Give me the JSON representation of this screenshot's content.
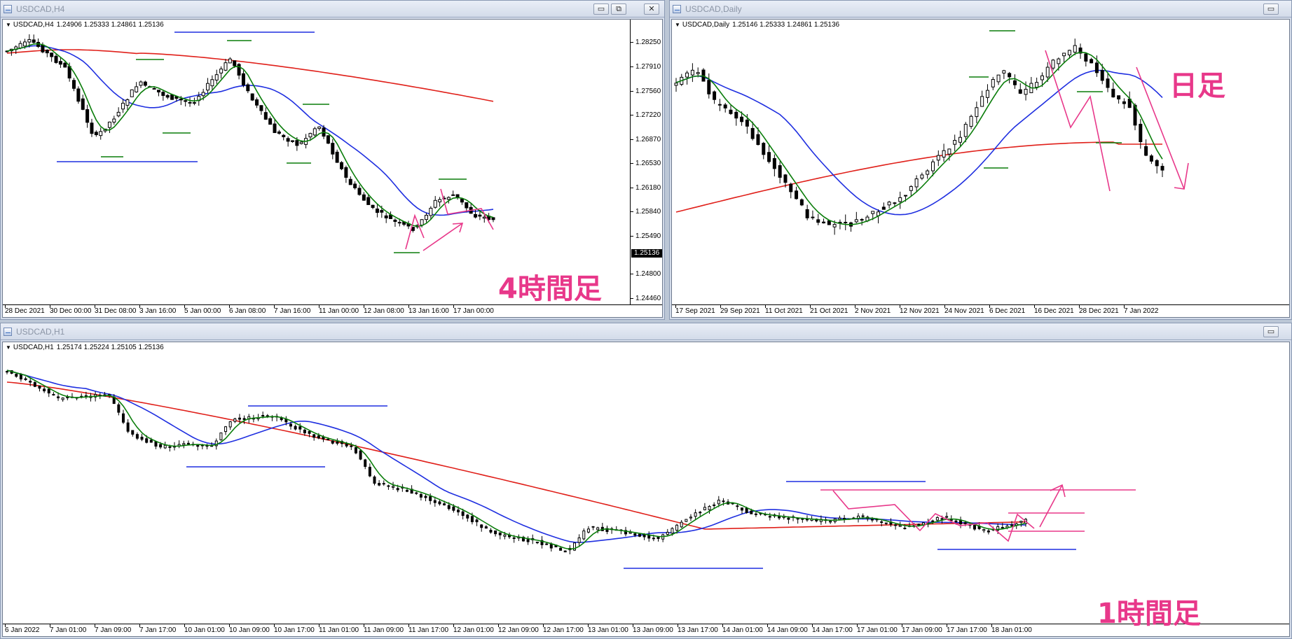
{
  "windows": {
    "h4": {
      "title": "USDCAD,H4",
      "symbol": "USDCAD,H4",
      "ohlc": "1.24906 1.25333 1.24861 1.25136",
      "y_ticks": [
        "1.28250",
        "1.27910",
        "1.27560",
        "1.27220",
        "1.26870",
        "1.26530",
        "1.26180",
        "1.25840",
        "1.25490",
        "1.25136",
        "1.24800",
        "1.24460"
      ],
      "current_price": "1.25136",
      "x_ticks": [
        "28 Dec 2021",
        "30 Dec 00:00",
        "31 Dec 08:00",
        "3 Jan 16:00",
        "5 Jan 00:00",
        "6 Jan 08:00",
        "7 Jan 16:00",
        "11 Jan 00:00",
        "12 Jan 08:00",
        "13 Jan 16:00",
        "17 Jan 00:00"
      ],
      "annotation": "4時間足"
    },
    "daily": {
      "title": "USDCAD,Daily",
      "symbol": "USDCAD,Daily",
      "ohlc": "1.25146 1.25333 1.24861 1.25136",
      "x_ticks": [
        "17 Sep 2021",
        "29 Sep 2021",
        "11 Oct 2021",
        "21 Oct 2021",
        "2 Nov 2021",
        "12 Nov 2021",
        "24 Nov 2021",
        "6 Dec 2021",
        "16 Dec 2021",
        "28 Dec 2021",
        "7 Jan 2022"
      ],
      "annotation": "日足"
    },
    "h1": {
      "title": "USDCAD,H1",
      "symbol": "USDCAD,H1",
      "ohlc": "1.25174 1.25224 1.25105 1.25136",
      "x_ticks": [
        "6 Jan 2022",
        "7 Jan 01:00",
        "7 Jan 09:00",
        "7 Jan 17:00",
        "10 Jan 01:00",
        "10 Jan 09:00",
        "10 Jan 17:00",
        "11 Jan 01:00",
        "11 Jan 09:00",
        "11 Jan 17:00",
        "12 Jan 01:00",
        "12 Jan 09:00",
        "12 Jan 17:00",
        "13 Jan 01:00",
        "13 Jan 09:00",
        "13 Jan 17:00",
        "14 Jan 01:00",
        "14 Jan 09:00",
        "14 Jan 17:00",
        "17 Jan 01:00",
        "17 Jan 09:00",
        "17 Jan 17:00",
        "18 Jan 01:00"
      ],
      "annotation": "1時間足"
    }
  },
  "buttons": {
    "minimize": "▭",
    "restore": "⧉",
    "close": "✕"
  },
  "colors": {
    "ma_short": "#0a7d0a",
    "ma_mid": "#1f2fe0",
    "ma_long": "#e0201a",
    "annotation": "#e8388a",
    "level_high": "#0a7d0a",
    "level_blue": "#1f2fe0"
  }
}
